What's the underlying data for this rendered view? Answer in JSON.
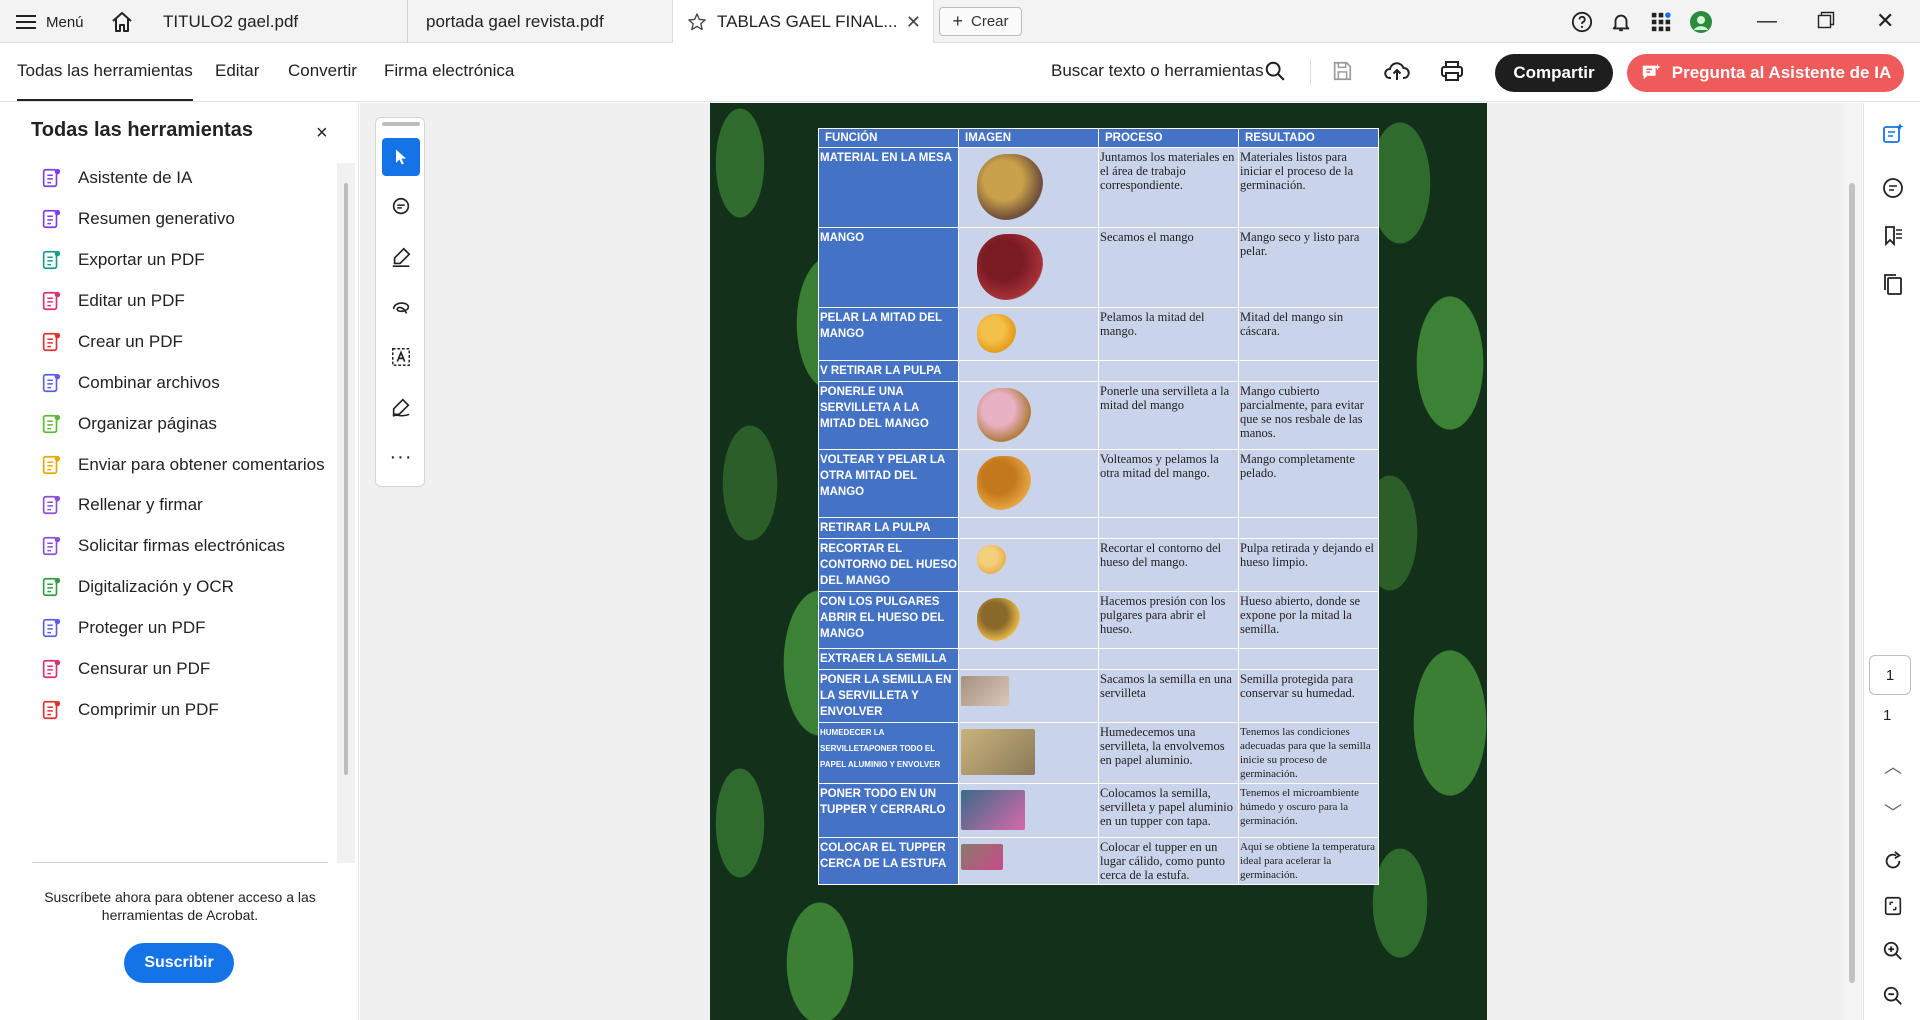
{
  "titlebar": {
    "menu_label": "Menú",
    "tabs": [
      {
        "label": "TITULO2 gael.pdf"
      },
      {
        "label": "portada gael revista.pdf"
      },
      {
        "label": "TABLAS GAEL FINAL..."
      }
    ],
    "create_label": "Crear"
  },
  "toolbar": {
    "items": [
      "Todas las herramientas",
      "Editar",
      "Convertir",
      "Firma electrónica"
    ],
    "search_label": "Buscar texto o herramientas",
    "share_label": "Compartir",
    "ai_label": "Pregunta al Asistente de IA"
  },
  "leftpanel": {
    "title": "Todas las herramientas",
    "close": "×",
    "items": [
      {
        "label": "Asistente de IA",
        "icon": "ai-assistant-icon",
        "color": "#7b3fe4"
      },
      {
        "label": "Resumen generativo",
        "icon": "generative-summary-icon",
        "color": "#7b3fe4"
      },
      {
        "label": "Exportar un PDF",
        "icon": "export-pdf-icon",
        "color": "#1a9c8c"
      },
      {
        "label": "Editar un PDF",
        "icon": "edit-pdf-icon",
        "color": "#d6336c"
      },
      {
        "label": "Crear un PDF",
        "icon": "create-pdf-icon",
        "color": "#e03131"
      },
      {
        "label": "Combinar archivos",
        "icon": "combine-files-icon",
        "color": "#5c5fe0"
      },
      {
        "label": "Organizar páginas",
        "icon": "organize-pages-icon",
        "color": "#5fb832"
      },
      {
        "label": "Enviar para obtener comentarios",
        "icon": "send-comments-icon",
        "color": "#e8a800"
      },
      {
        "label": "Rellenar y firmar",
        "icon": "fill-sign-icon",
        "color": "#8c4fd8"
      },
      {
        "label": "Solicitar firmas electrónicas",
        "icon": "request-signatures-icon",
        "color": "#8c4fd8"
      },
      {
        "label": "Digitalización y OCR",
        "icon": "scan-ocr-icon",
        "color": "#2f9e44"
      },
      {
        "label": "Proteger un PDF",
        "icon": "protect-pdf-icon",
        "color": "#5c5fe0"
      },
      {
        "label": "Censurar un PDF",
        "icon": "redact-pdf-icon",
        "color": "#d6336c"
      },
      {
        "label": "Comprimir un PDF",
        "icon": "compress-pdf-icon",
        "color": "#e03131"
      }
    ],
    "promo": "Suscríbete ahora para obtener acceso a las herramientas de Acrobat.",
    "subscribe_label": "Suscribir"
  },
  "document": {
    "headers": [
      "FUNCIÓN",
      "IMAGEN",
      "PROCESO",
      "RESULTADO"
    ],
    "rows": [
      {
        "funcion": "MATERIAL EN LA MESA",
        "proceso": "Juntamos los materiales en el área de trabajo correspondiente.",
        "resultado": "Materiales listos para iniciar el proceso de la germinación."
      },
      {
        "funcion": "MANGO",
        "proceso": "Secamos el mango",
        "resultado": "Mango seco y listo para pelar."
      },
      {
        "funcion": "PELAR LA MITAD DEL MANGO",
        "proceso": "Pelamos la mitad del mango.",
        "resultado": "Mitad del mango sin cáscara."
      },
      {
        "funcion": "V RETIRAR LA PULPA",
        "proceso": "",
        "resultado": ""
      },
      {
        "funcion": "PONERLE UNA SERVILLETA A LA MITAD DEL MANGO",
        "proceso": "Ponerle una servilleta a la mitad del mango",
        "resultado": "Mango cubierto parcialmente, para evitar que se nos resbale de las manos."
      },
      {
        "funcion": "VOLTEAR Y PELAR LA OTRA MITAD DEL MANGO",
        "proceso": "Volteamos y pelamos la otra mitad del mango.",
        "resultado": "Mango completamente pelado."
      },
      {
        "funcion": "RETIRAR LA PULPA",
        "proceso": "",
        "resultado": ""
      },
      {
        "funcion": "RECORTAR EL CONTORNO DEL HUESO DEL MANGO",
        "proceso": "Recortar el contorno del hueso del mango.",
        "resultado": "Pulpa retirada y dejando el hueso limpio."
      },
      {
        "funcion": "CON LOS PULGARES ABRIR EL HUESO DEL MANGO",
        "proceso": "Hacemos presión con los pulgares para abrir el hueso.",
        "resultado": "Hueso abierto, donde se expone por la mitad la semilla."
      },
      {
        "funcion": "EXTRAER LA SEMILLA",
        "proceso": "",
        "resultado": ""
      },
      {
        "funcion": "PONER LA SEMILLA EN LA SERVILLETA Y ENVOLVER",
        "proceso": "Sacamos la semilla en una servilleta",
        "resultado": "Semilla protegida para conservar su humedad."
      },
      {
        "funcion": "HUMEDECER LA SERVILLETAPONER TODO EL PAPEL ALUMINIO Y ENVOLVER",
        "proceso": "Humedecemos una servilleta, la envolvemos en papel aluminio.",
        "resultado": "Tenemos las condiciones adecuadas para que la semilla inicie su proceso de germinación."
      },
      {
        "funcion": "PONER TODO EN UN TUPPER Y CERRARLO",
        "proceso": "Colocamos la semilla, servilleta y papel aluminio en un tupper con tapa.",
        "resultado": "Tenemos el microambiente húmedo y oscuro para la germinación."
      },
      {
        "funcion": "COLOCAR EL TUPPER CERCA DE LA ESTUFA",
        "proceso": "Colocar el tupper en un lugar cálido, como punto cerca de la estufa.",
        "resultado": "Aquí se obtiene la temperatura ideal para acelerar la germinación."
      }
    ]
  },
  "navigation": {
    "current_page": "1",
    "total_pages": "1"
  },
  "colors": {
    "table_header": "#4472c4",
    "table_cell": "#c9d3ea",
    "accent_blue": "#1473e6",
    "ai_button": "#ef5a5a"
  }
}
